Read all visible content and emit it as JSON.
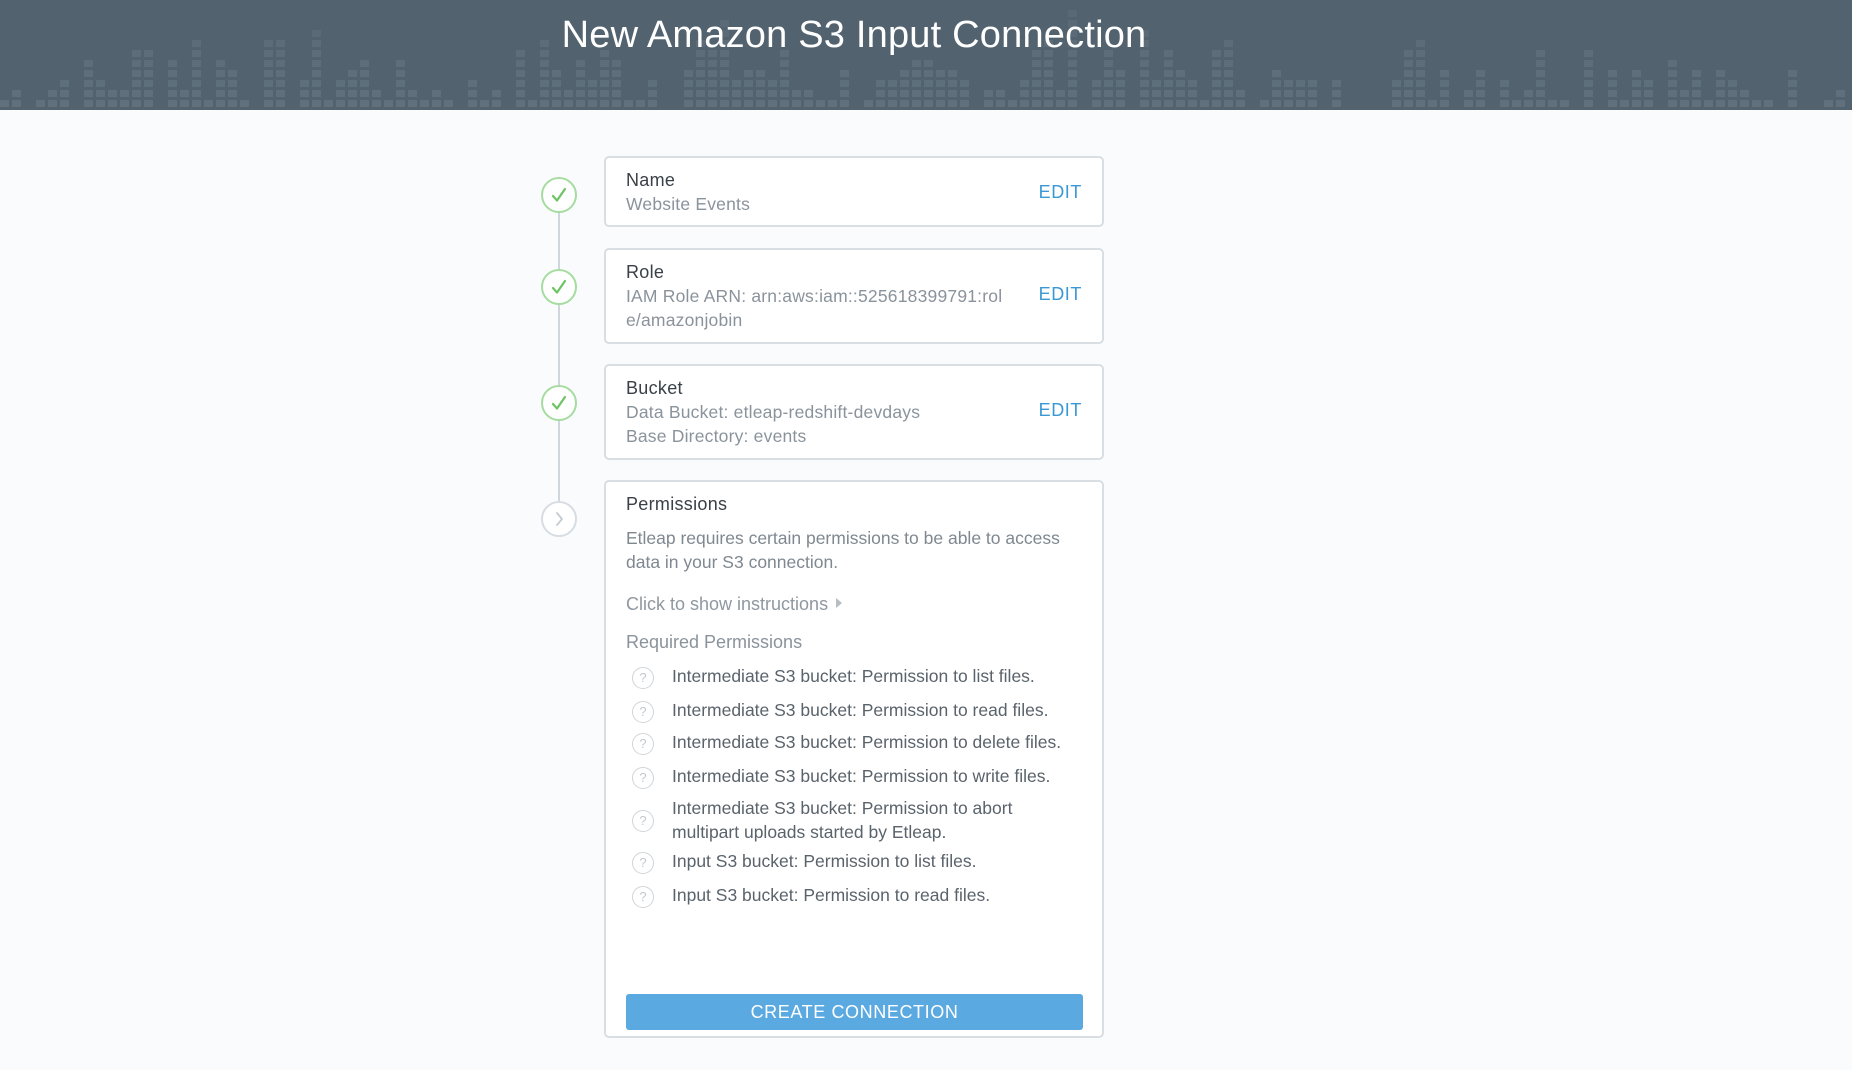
{
  "header": {
    "title": "New Amazon S3 Input Connection"
  },
  "steps": {
    "name": {
      "title": "Name",
      "lines": [
        "Website Events"
      ],
      "edit_label": "EDIT",
      "status": "complete"
    },
    "role": {
      "title": "Role",
      "lines": [
        "IAM Role ARN: arn:aws:iam::525618399791:rol",
        "e/amazonjobin"
      ],
      "edit_label": "EDIT",
      "status": "complete"
    },
    "bucket": {
      "title": "Bucket",
      "lines": [
        "Data Bucket: etleap-redshift-devdays",
        "Base Directory: events"
      ],
      "edit_label": "EDIT",
      "status": "complete"
    },
    "permissions": {
      "title": "Permissions",
      "status": "current",
      "description": [
        "Etleap requires certain permissions to be able to access",
        "data in your S3 connection."
      ],
      "show_instructions": "Click to show instructions",
      "required_heading": "Required Permissions",
      "items": [
        {
          "lines": [
            "Intermediate S3 bucket: Permission to list files."
          ]
        },
        {
          "lines": [
            "Intermediate S3 bucket: Permission to read files."
          ]
        },
        {
          "lines": [
            "Intermediate S3 bucket: Permission to delete files."
          ]
        },
        {
          "lines": [
            "Intermediate S3 bucket: Permission to write files."
          ]
        },
        {
          "lines": [
            "Intermediate S3 bucket: Permission to abort",
            "multipart uploads started by Etleap."
          ]
        },
        {
          "lines": [
            "Input S3 bucket: Permission to list files."
          ]
        },
        {
          "lines": [
            "Input S3 bucket: Permission to read files."
          ]
        }
      ],
      "create_button": "CREATE CONNECTION"
    }
  },
  "icons": {
    "complete": "check-icon",
    "current": "chevron-right-icon",
    "help": "question-icon"
  },
  "colors": {
    "header_bg": "#52636f",
    "accent": "#3a98d5",
    "button": "#5ba9e1",
    "success": "#7fcf75"
  }
}
